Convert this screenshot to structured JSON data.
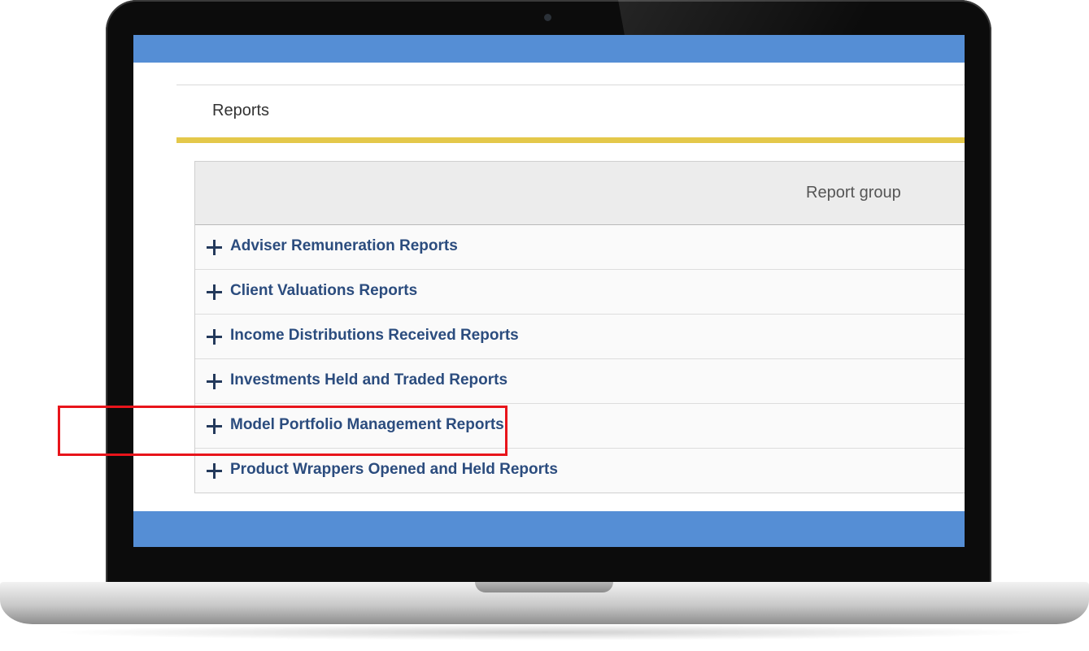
{
  "page": {
    "title": "Reports"
  },
  "table": {
    "column_header": "Report group",
    "rows": [
      {
        "label": "Adviser Remuneration Reports",
        "icon": "plus-icon"
      },
      {
        "label": "Client Valuations Reports",
        "icon": "plus-icon"
      },
      {
        "label": "Income Distributions Received Reports",
        "icon": "plus-icon"
      },
      {
        "label": "Investments Held and Traded Reports",
        "icon": "plus-icon"
      },
      {
        "label": "Model Portfolio Management Reports",
        "icon": "plus-icon"
      },
      {
        "label": "Product Wrappers Opened and Held Reports",
        "icon": "plus-icon"
      }
    ],
    "highlighted_row": "Product Wrappers Opened and Held Reports"
  },
  "colors": {
    "bar_blue": "#558ed5",
    "accent_yellow": "#e4c84a",
    "link_blue": "#2b4c7e",
    "highlight_red": "#e8141b"
  }
}
